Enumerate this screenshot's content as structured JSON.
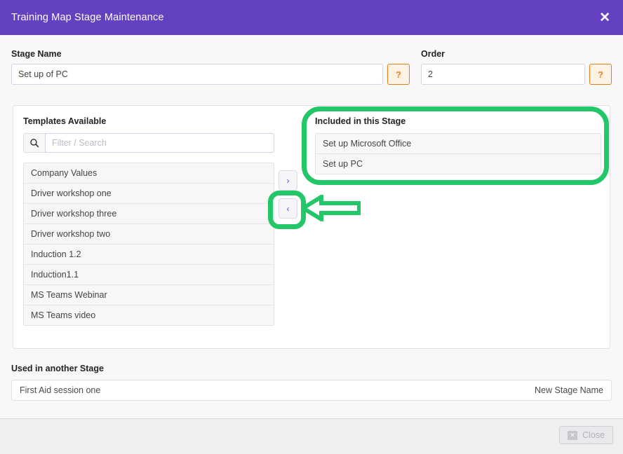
{
  "titlebar": {
    "title": "Training Map Stage Maintenance",
    "close_icon": "close-x-icon",
    "background_color": "#6341c0"
  },
  "fields": {
    "stage_name": {
      "label": "Stage Name",
      "value": "Set up of PC",
      "placeholder": "",
      "help_label": "?"
    },
    "order": {
      "label": "Order",
      "value": "2",
      "placeholder": "",
      "help_label": "?"
    }
  },
  "templates_panel": {
    "title": "Templates Available",
    "search": {
      "icon": "search-icon",
      "placeholder": "Filter / Search",
      "value": ""
    },
    "items": [
      "Company Values",
      "Driver workshop one",
      "Driver workshop three",
      "Driver workshop two",
      "Induction 1.2",
      "Induction1.1",
      "MS Teams Webinar",
      "MS Teams video"
    ]
  },
  "transfer": {
    "add_label": "›",
    "remove_label": "‹"
  },
  "included_panel": {
    "title": "Included in this Stage",
    "items": [
      "Set up Microsoft Office",
      "Set up PC"
    ]
  },
  "used_section": {
    "title": "Used in another Stage",
    "stage_name": "First Aid session one",
    "new_stage_label": "New Stage Name"
  },
  "footer": {
    "close_label": "Close",
    "close_icon": "x-badge-icon"
  },
  "annotations": {
    "color": "#23c768",
    "highlight_rect": "included-in-this-stage-panel",
    "highlight_circle": "remove-from-stage-button",
    "arrow": "arrow-pointing-left-at-remove-button"
  }
}
